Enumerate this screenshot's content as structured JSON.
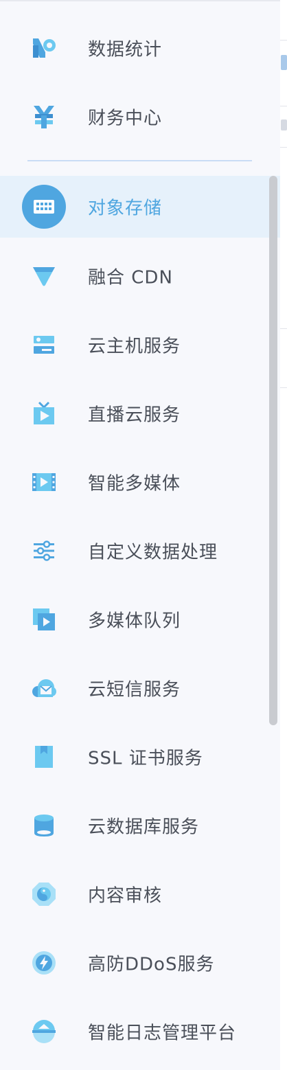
{
  "sidebar": {
    "items": [
      {
        "label": "数据统计",
        "icon": "statistics-icon"
      },
      {
        "label": "财务中心",
        "icon": "yuan-icon"
      },
      {
        "label": "对象存储",
        "icon": "storage-icon",
        "active": true
      },
      {
        "label": "融合 CDN",
        "icon": "cdn-icon"
      },
      {
        "label": "云主机服务",
        "icon": "server-icon"
      },
      {
        "label": "直播云服务",
        "icon": "tv-play-icon"
      },
      {
        "label": "智能多媒体",
        "icon": "film-play-icon"
      },
      {
        "label": "自定义数据处理",
        "icon": "sliders-icon"
      },
      {
        "label": "多媒体队列",
        "icon": "queue-play-icon"
      },
      {
        "label": "云短信服务",
        "icon": "cloud-mail-icon"
      },
      {
        "label": "SSL 证书服务",
        "icon": "bookmark-certificate-icon"
      },
      {
        "label": "云数据库服务",
        "icon": "database-icon"
      },
      {
        "label": "内容审核",
        "icon": "content-audit-icon"
      },
      {
        "label": "高防DDoS服务",
        "icon": "lightning-shield-icon"
      },
      {
        "label": "智能日志管理平台",
        "icon": "log-platform-icon"
      }
    ]
  },
  "colors": {
    "accent": "#4fa6e0",
    "active_bg": "#e6f1fb",
    "text": "#4a4f59",
    "sidebar_bg": "#f7f8fc",
    "divider": "#c9dcf5"
  }
}
